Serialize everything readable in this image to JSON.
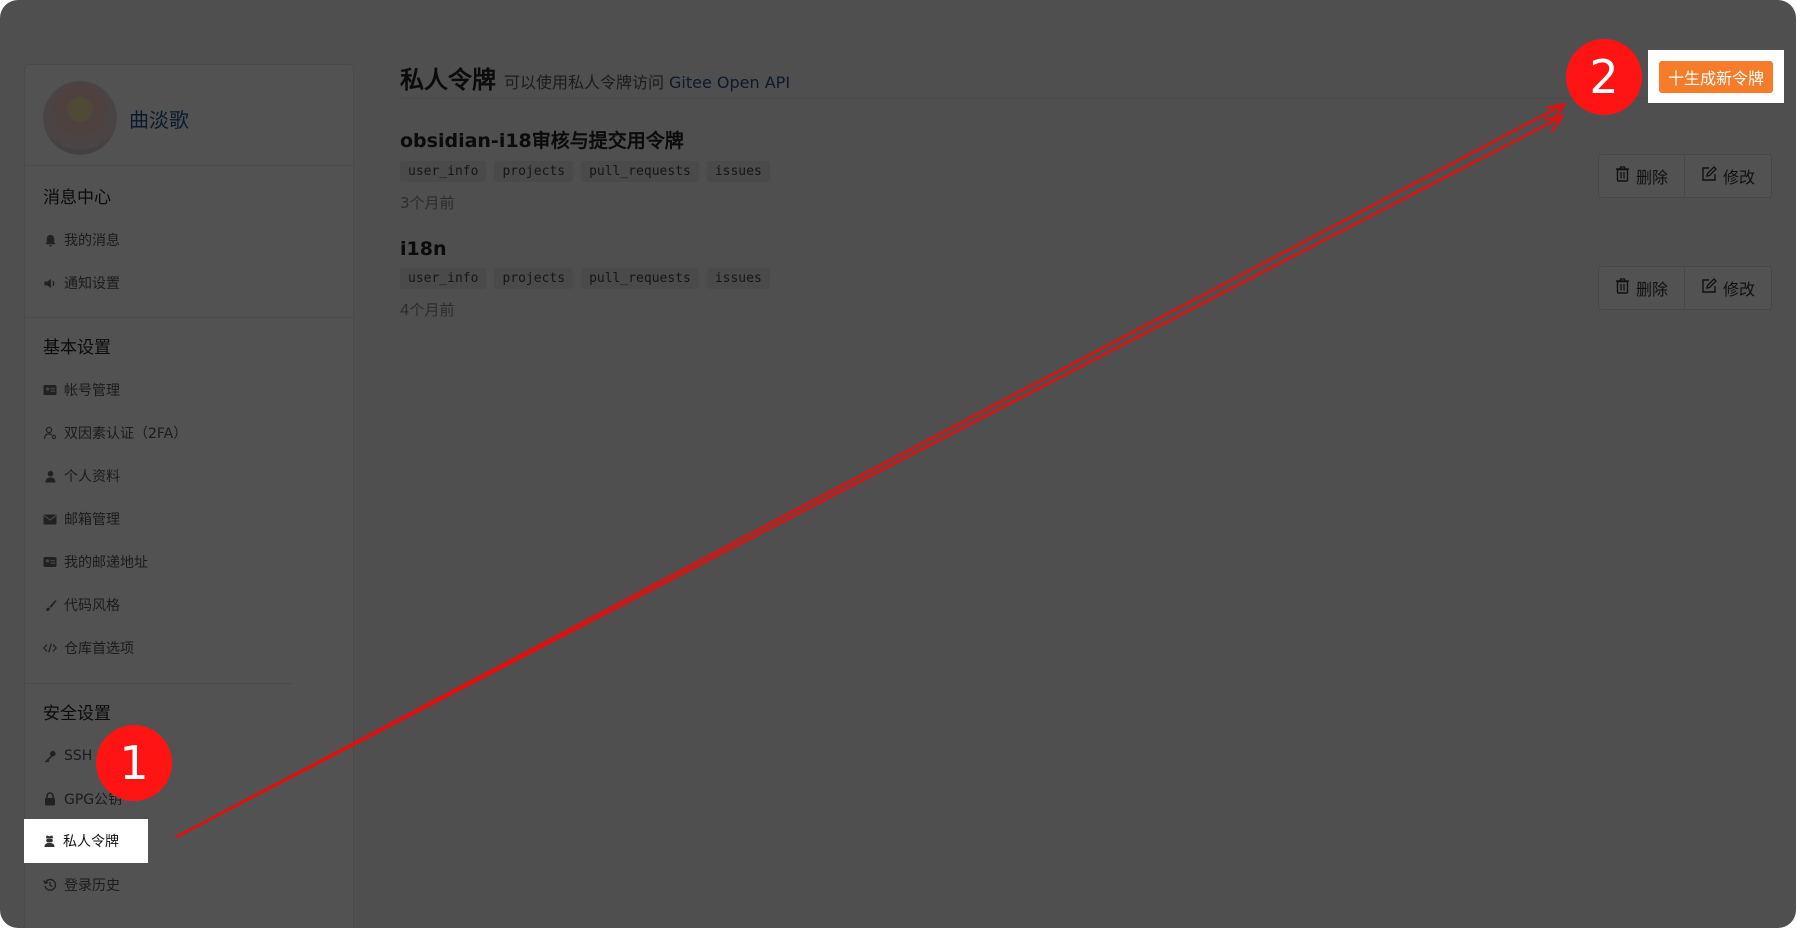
{
  "sidebar": {
    "username": "曲淡歌",
    "sections": [
      {
        "title": "消息中心",
        "items": [
          {
            "label": "我的消息",
            "icon": "bell-icon"
          },
          {
            "label": "通知设置",
            "icon": "speaker-icon"
          }
        ]
      },
      {
        "title": "基本设置",
        "items": [
          {
            "label": "帐号管理",
            "icon": "id-card-icon"
          },
          {
            "label": "双因素认证（2FA）",
            "icon": "user-key-icon"
          },
          {
            "label": "个人资料",
            "icon": "user-icon"
          },
          {
            "label": "邮箱管理",
            "icon": "envelope-icon"
          },
          {
            "label": "我的邮递地址",
            "icon": "address-card-icon"
          },
          {
            "label": "代码风格",
            "icon": "brush-icon"
          },
          {
            "label": "仓库首选项",
            "icon": "code-icon"
          }
        ]
      },
      {
        "title": "安全设置",
        "items": [
          {
            "label": "SSH",
            "icon": "key-icon"
          },
          {
            "label": "GPG公钥",
            "icon": "lock-icon"
          },
          {
            "label": "私人令牌",
            "icon": "user-secret-icon"
          },
          {
            "label": "登录历史",
            "icon": "history-icon"
          }
        ]
      }
    ]
  },
  "main": {
    "title": "私人令牌",
    "desc": "可以使用私人令牌访问",
    "link": "Gitee Open API",
    "generate_label": "十生成新令牌",
    "tokens": [
      {
        "name": "obsidian-i18审核与提交用令牌",
        "scopes": [
          "user_info",
          "projects",
          "pull_requests",
          "issues"
        ],
        "time": "3个月前"
      },
      {
        "name": "i18n",
        "scopes": [
          "user_info",
          "projects",
          "pull_requests",
          "issues"
        ],
        "time": "4个月前"
      }
    ],
    "delete_label": "删除",
    "edit_label": "修改"
  },
  "annotations": {
    "step1": "1",
    "step2": "2",
    "arrow_color": "#e01010",
    "marker_color": "#ff1414"
  },
  "colors": {
    "accent": "#f57c2b",
    "link": "#1f4e8c"
  }
}
